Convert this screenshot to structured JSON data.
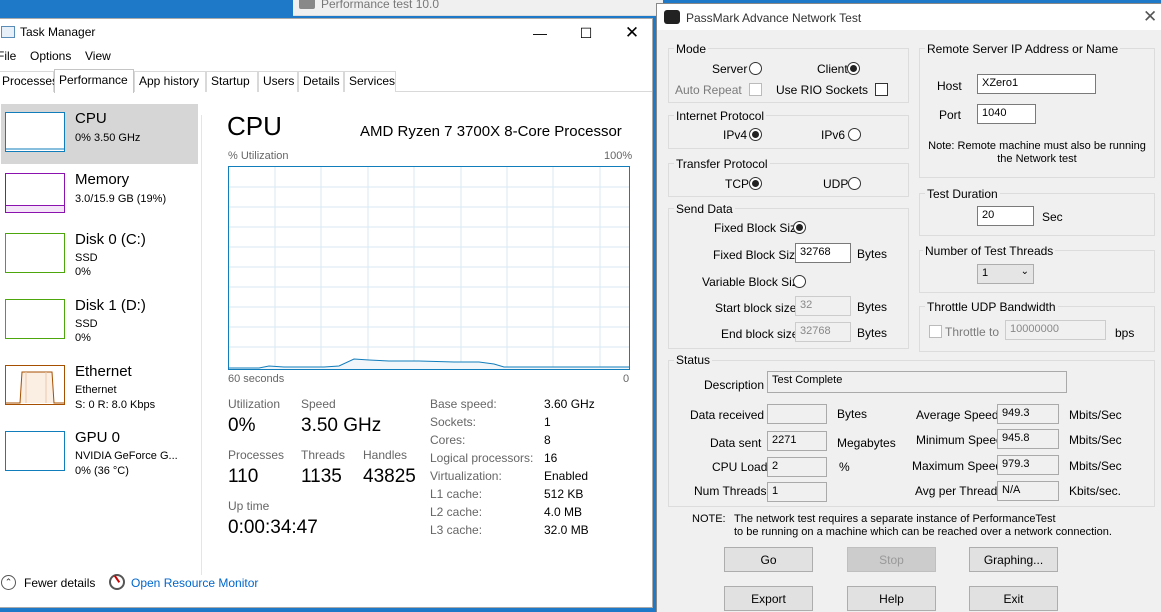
{
  "background_window": {
    "title": "Performance test 10.0"
  },
  "task_manager": {
    "title": "Task Manager",
    "menu": [
      "File",
      "Options",
      "View"
    ],
    "tabs": [
      "Processes",
      "Performance",
      "App history",
      "Startup",
      "Users",
      "Details",
      "Services"
    ],
    "sidebar": [
      {
        "name": "CPU",
        "lines": [
          "0% 3.50 GHz"
        ],
        "color": "#117dbb"
      },
      {
        "name": "Memory",
        "lines": [
          "3.0/15.9 GB (19%)"
        ],
        "color": "#8b12ae"
      },
      {
        "name": "Disk 0 (C:)",
        "lines": [
          "SSD",
          "0%"
        ],
        "color": "#4da60c"
      },
      {
        "name": "Disk 1 (D:)",
        "lines": [
          "SSD",
          "0%"
        ],
        "color": "#4da60c"
      },
      {
        "name": "Ethernet",
        "lines": [
          "Ethernet",
          "S: 0 R: 8.0 Kbps"
        ],
        "color": "#a74f01"
      },
      {
        "name": "GPU 0",
        "lines": [
          "NVIDIA GeForce G...",
          "0% (36 °C)"
        ],
        "color": "#117dbb"
      }
    ],
    "cpu": {
      "heading": "CPU",
      "processor": "AMD Ryzen 7 3700X 8-Core Processor",
      "graph_label": "% Utilization",
      "graph_max": "100%",
      "time_label": "60 seconds",
      "time_min": "0",
      "utilization_label": "Utilization",
      "utilization": "0%",
      "speed_label": "Speed",
      "speed": "3.50 GHz",
      "processes_label": "Processes",
      "processes": "110",
      "threads_label": "Threads",
      "threads": "1135",
      "handles_label": "Handles",
      "handles": "43825",
      "uptime_label": "Up time",
      "uptime": "0:00:34:47",
      "details": [
        {
          "label": "Base speed:",
          "value": "3.60 GHz"
        },
        {
          "label": "Sockets:",
          "value": "1"
        },
        {
          "label": "Cores:",
          "value": "8"
        },
        {
          "label": "Logical processors:",
          "value": "16"
        },
        {
          "label": "Virtualization:",
          "value": "Enabled"
        },
        {
          "label": "L1 cache:",
          "value": "512 KB"
        },
        {
          "label": "L2 cache:",
          "value": "4.0 MB"
        },
        {
          "label": "L3 cache:",
          "value": "32.0 MB"
        }
      ]
    },
    "footer": {
      "fewer_details": "Fewer details",
      "resource_monitor": "Open Resource Monitor"
    }
  },
  "passmark": {
    "title": "PassMark Advance Network Test",
    "mode": {
      "group": "Mode",
      "server": "Server",
      "client": "Client",
      "selected": "client",
      "auto_repeat": "Auto Repeat",
      "use_rio": "Use RIO Sockets"
    },
    "internet_protocol": {
      "group": "Internet Protocol",
      "ipv4": "IPv4",
      "ipv6": "IPv6",
      "selected": "ipv4"
    },
    "transfer_protocol": {
      "group": "Transfer Protocol",
      "tcp": "TCP",
      "udp": "UDP",
      "selected": "tcp"
    },
    "send_data": {
      "group": "Send Data",
      "fixed_label": "Fixed Block Size",
      "fixed_size_label": "Fixed Block Size",
      "fixed_size": "32768",
      "bytes": "Bytes",
      "variable_label": "Variable Block Size",
      "start_label": "Start block size",
      "start_value": "32",
      "end_label": "End block size",
      "end_value": "32768"
    },
    "remote": {
      "group": "Remote Server IP Address or Name",
      "host_label": "Host",
      "host": "XZero1",
      "port_label": "Port",
      "port": "1040",
      "note": "Note: Remote machine must also be running the Network test"
    },
    "duration": {
      "group": "Test Duration",
      "value": "20",
      "unit": "Sec"
    },
    "threads": {
      "group": "Number of Test Threads",
      "value": "1"
    },
    "throttle": {
      "group": "Throttle UDP Bandwidth",
      "label": "Throttle to",
      "value": "10000000",
      "unit": "bps"
    },
    "status": {
      "group": "Status",
      "description_label": "Description",
      "description": "Test Complete",
      "received_label": "Data received",
      "received": "",
      "received_unit": "Bytes",
      "sent_label": "Data sent",
      "sent": "2271",
      "sent_unit": "Megabytes",
      "cpu_label": "CPU Load",
      "cpu": "2",
      "cpu_unit": "%",
      "num_threads_label": "Num Threads",
      "num_threads": "1",
      "avg_label": "Average Speed",
      "avg": "949.3",
      "avg_unit": "Mbits/Sec",
      "min_label": "Minimum Speed",
      "min": "945.8",
      "min_unit": "Mbits/Sec",
      "max_label": "Maximum Speed",
      "max": "979.3",
      "max_unit": "Mbits/Sec",
      "per_thread_label": "Avg per Thread",
      "per_thread": "N/A",
      "per_thread_unit": "Kbits/sec."
    },
    "note_label": "NOTE:",
    "note_line1": "The network test requires a separate instance of PerformanceTest",
    "note_line2": "to be running on a machine which can be reached over a network connection.",
    "buttons": {
      "go": "Go",
      "stop": "Stop",
      "graphing": "Graphing...",
      "export": "Export",
      "help": "Help",
      "exit": "Exit"
    }
  }
}
